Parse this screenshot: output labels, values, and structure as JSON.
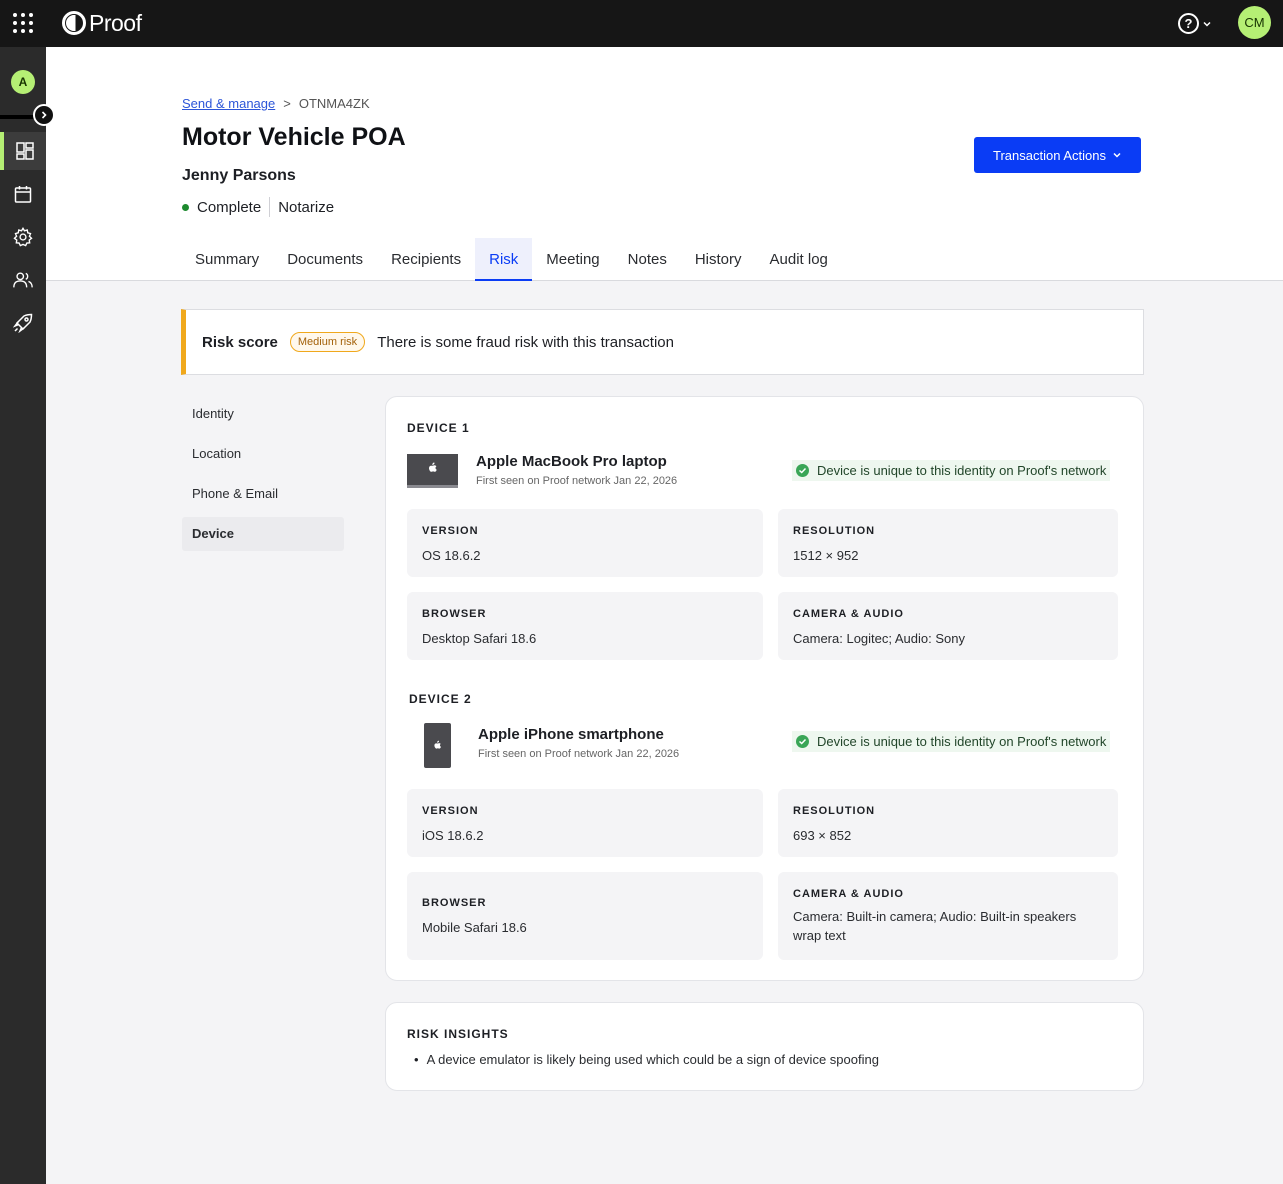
{
  "app": {
    "brand": "Proof",
    "user_initials": "CM",
    "org_initial": "A",
    "help_label": "?"
  },
  "sidebar": {
    "items": [
      {
        "name": "dashboard-icon",
        "active": true
      },
      {
        "name": "calendar-icon",
        "active": false
      },
      {
        "name": "gear-icon",
        "active": false
      },
      {
        "name": "users-icon",
        "active": false
      },
      {
        "name": "rocket-icon",
        "active": false
      }
    ]
  },
  "breadcrumb": {
    "link": "Send & manage",
    "separator": ">",
    "current": "OTNMA4ZK"
  },
  "transaction": {
    "title": "Motor Vehicle POA",
    "signer": "Jenny Parsons",
    "status": "Complete",
    "type": "Notarize",
    "actions_label": "Transaction Actions"
  },
  "tabs": [
    {
      "label": "Summary",
      "active": false
    },
    {
      "label": "Documents",
      "active": false
    },
    {
      "label": "Recipients",
      "active": false
    },
    {
      "label": "Risk",
      "active": true
    },
    {
      "label": "Meeting",
      "active": false
    },
    {
      "label": "Notes",
      "active": false
    },
    {
      "label": "History",
      "active": false
    },
    {
      "label": "Audit log",
      "active": false
    }
  ],
  "risk": {
    "label": "Risk score",
    "badge": "Medium risk",
    "message": "There is some fraud risk with this transaction"
  },
  "subnav": [
    {
      "label": "Identity",
      "active": false
    },
    {
      "label": "Location",
      "active": false
    },
    {
      "label": "Phone & Email",
      "active": false
    },
    {
      "label": "Device",
      "active": true
    }
  ],
  "devices": [
    {
      "heading": "DEVICE 1",
      "name": "Apple MacBook Pro laptop",
      "first_seen": "First seen on Proof network Jan 22, 2026",
      "unique": "Device is unique to this identity on Proof's network",
      "version_label": "VERSION",
      "version": "OS 18.6.2",
      "resolution_label": "RESOLUTION",
      "resolution": "1512 × 952",
      "browser_label": "BROWSER",
      "browser": "Desktop Safari 18.6",
      "camera_label": "CAMERA & AUDIO",
      "camera": "Camera: Logitec; Audio: Sony"
    },
    {
      "heading": "DEVICE 2",
      "name": "Apple iPhone smartphone",
      "first_seen": "First seen on Proof network Jan 22, 2026",
      "unique": "Device is unique to this identity on Proof's network",
      "version_label": "VERSION",
      "version": "iOS 18.6.2",
      "resolution_label": "RESOLUTION",
      "resolution": "693 × 852",
      "browser_label": "BROWSER",
      "browser": "Mobile Safari 18.6",
      "camera_label": "CAMERA & AUDIO",
      "camera": "Camera: Built-in camera; Audio: Built-in speakers wrap text"
    }
  ],
  "insights": {
    "heading": "RISK INSIGHTS",
    "items": [
      "A device emulator is likely being used which could be a sign of device spoofing"
    ]
  },
  "colors": {
    "accent": "#0a3cf5",
    "brand_green": "#b5ef74",
    "warning": "#f0a81c",
    "success": "#3aa657"
  }
}
